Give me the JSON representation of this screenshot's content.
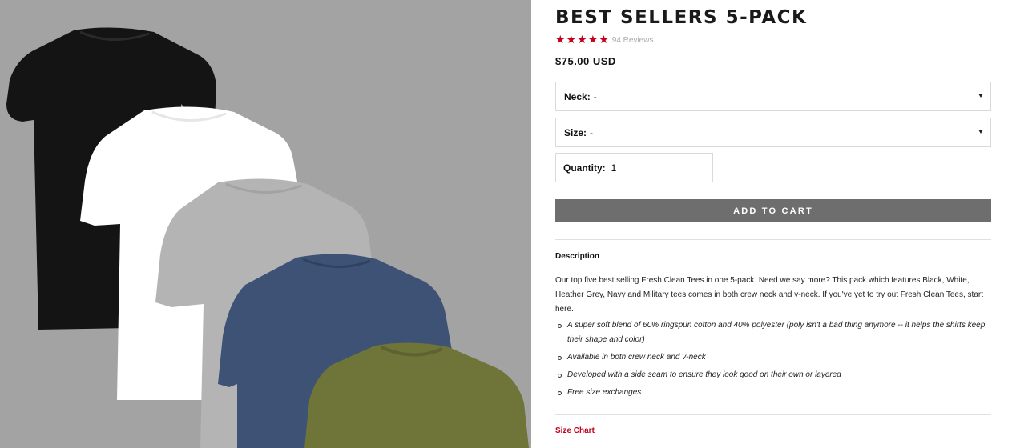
{
  "product": {
    "title": "BEST SELLERS 5-PACK",
    "stars": "★★★★★",
    "reviews": "94 Reviews",
    "price": "$75.00 USD"
  },
  "options": {
    "neck_label": "Neck:",
    "neck_value": "-",
    "size_label": "Size:",
    "size_value": "-",
    "quantity_label": "Quantity:",
    "quantity_value": "1"
  },
  "cart": {
    "label": "ADD TO CART"
  },
  "description": {
    "heading": "Description",
    "body": "Our top five best selling Fresh Clean Tees in one 5-pack. Need we say more? This pack which features Black, White, Heather Grey, Navy and Military tees comes in both crew neck and v-neck. If you've yet to try out Fresh Clean Tees, start here.",
    "bullets": [
      "A super soft blend of 60% ringspun cotton and 40% polyester (poly isn't a bad thing anymore -- it helps the shirts keep their shape and color)",
      "Available in both crew neck and v-neck",
      "Developed with a side seam to ensure they look good on their own or layered",
      "Free size exchanges"
    ]
  },
  "size_chart": {
    "label": "Size Chart"
  },
  "colors": {
    "accent": "#c4001a",
    "cart_button": "#6e6e6e",
    "gallery_bg": "#a3a3a3",
    "tee_black": "#141414",
    "tee_white": "#ffffff",
    "tee_grey": "#b4b4b4",
    "tee_navy": "#3d5275",
    "tee_military": "#6f7438"
  }
}
